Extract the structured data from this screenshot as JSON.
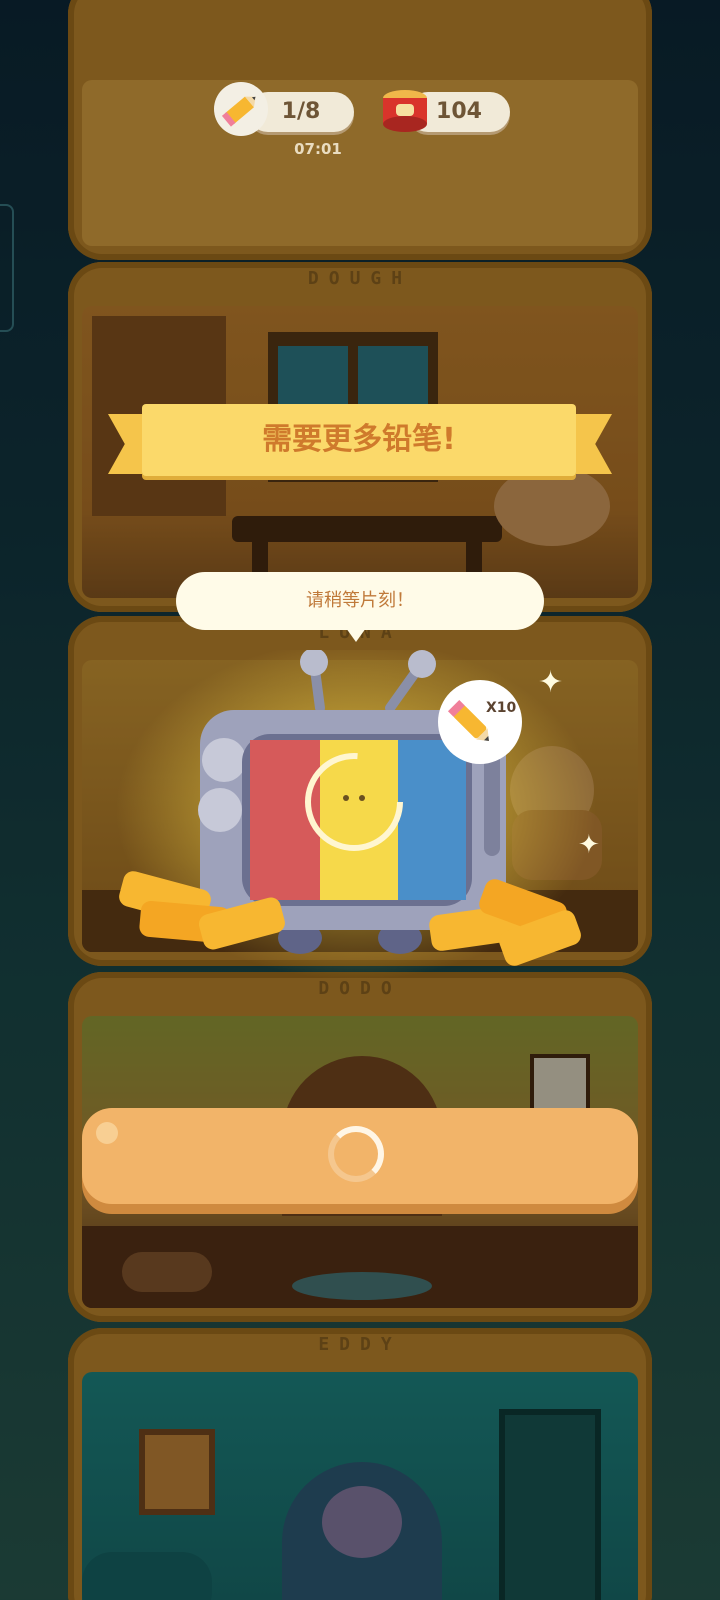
{
  "hud": {
    "pencils": "1/8",
    "timer": "07:01",
    "cans": "104"
  },
  "floors": [
    {
      "name": "DOUGH"
    },
    {
      "name": "LUNA"
    },
    {
      "name": "DODO"
    },
    {
      "name": "EDDY"
    }
  ],
  "popup": {
    "title": "需要更多铅笔!",
    "message": "请稍等片刻！",
    "reward_badge": "X10"
  },
  "colors": {
    "ribbon": "#fbd96a",
    "ribbon_text": "#cf7a2c",
    "button": "#f2b469",
    "bubble": "#fffbe8"
  }
}
